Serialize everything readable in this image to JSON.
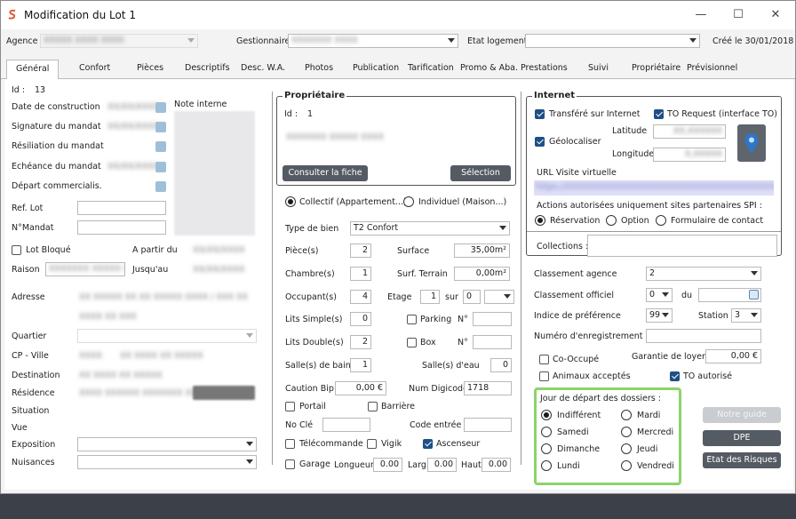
{
  "window": {
    "title": "Modification du Lot 1",
    "btn_min": "—",
    "btn_max": "☐",
    "btn_close": "✕"
  },
  "header": {
    "agence_label": "Agence",
    "agence_value": "XXXXX XXXX XXXX",
    "gestionnaire_label": "Gestionnaire",
    "gestionnaire_value": "XXXXXXX XXXX",
    "etat_label": "Etat logement",
    "etat_value": "",
    "created": "Créé le 30/01/2018"
  },
  "tabs": [
    "Général",
    "Confort",
    "Pièces",
    "Descriptifs",
    "Desc. W.A.",
    "Photos",
    "Publication",
    "Tarification",
    "Promo & Aba.",
    "Prestations",
    "Suivi",
    "Propriétaire",
    "Prévisionnel"
  ],
  "left": {
    "id_label": "Id :",
    "id_value": "13",
    "date_construction": "Date de construction",
    "signature_mandat": "Signature du mandat",
    "resiliation_mandat": "Résiliation du mandat",
    "echeance_mandat": "Echéance du mandat",
    "depart_commercialis": "Départ commercialis.",
    "note_interne": "Note interne",
    "date_blur1": "XX/XX/XXXX",
    "date_blur2": "XX/XX/XXXX",
    "date_blur3": "XX/XX/XXXX",
    "ref_lot": "Ref. Lot",
    "n_mandat": "N°Mandat",
    "lot_bloque": "Lot Bloqué",
    "a_partir_du": "A partir du",
    "raison": "Raison",
    "jusquau": "Jusqu'au",
    "raison_value": "XXXXXXX XXXXX XXXXX",
    "date_from": "XX/XX/XXXX",
    "date_to": "XX/XX/XXXX",
    "adresse": "Adresse",
    "adresse_line1": "XX XXXXX XX XX XXXXX XXXX / XXX XX",
    "adresse_line2": "XXXX XX XXX",
    "quartier": "Quartier",
    "cp_ville": "CP - Ville",
    "cp_value": "XXXX",
    "ville_value": "XX XXXX XX XXXXX",
    "destination": "Destination",
    "destination_value": "XX XXXX XX XXXXX",
    "residence": "Résidence",
    "residence_value": "XXXX XXXXXX XXXXXXX XX",
    "situation": "Situation",
    "vue": "Vue",
    "exposition": "Exposition",
    "nuisances": "Nuisances"
  },
  "middle": {
    "proprietaire_title": "Propriétaire",
    "id_label": "Id :",
    "id_value": "1",
    "owner_blur": "XXXXXXX XXXXX XXXX",
    "consulter_btn": "Consulter la fiche",
    "selection_btn": "Sélection",
    "collectif": "Collectif (Appartement...)",
    "individuel": "Individuel (Maison...)",
    "type_bien_label": "Type de bien",
    "type_bien_value": "T2 Confort",
    "pieces": "Pièce(s)",
    "pieces_value": "2",
    "surface": "Surface",
    "surface_value": "35,00m²",
    "chambres": "Chambre(s)",
    "chambres_value": "1",
    "surf_terrain": "Surf. Terrain",
    "surf_terrain_value": "0,00m²",
    "occupants": "Occupant(s)",
    "occupants_value": "4",
    "etage": "Etage",
    "etage_value": "1",
    "sur": "sur",
    "sur_value": "0",
    "lits_simple": "Lits Simple(s)",
    "lits_simple_value": "0",
    "parking": "Parking",
    "no_label": "N°",
    "lits_double": "Lits Double(s)",
    "lits_double_value": "2",
    "box": "Box",
    "salles_bains": "Salle(s) de bains",
    "salles_bains_value": "1",
    "salles_eau": "Salle(s) d'eau",
    "salles_eau_value": "0",
    "caution_bip": "Caution Bip",
    "caution_value": "0,00 €",
    "num_digicode": "Num Digicode",
    "digicode_value": "1718",
    "portail": "Portail",
    "barriere": "Barrière",
    "no_cle": "No Clé",
    "code_entree": "Code entrée",
    "telecommande": "Télécommande",
    "vigik": "Vigik",
    "ascenseur": "Ascenseur",
    "garage": "Garage",
    "longueur": "Longueur",
    "longueur_value": "0.00",
    "larg": "Larg.",
    "larg_value": "0.00",
    "haut": "Haut.",
    "haut_value": "0.00"
  },
  "right": {
    "internet_title": "Internet",
    "transfere": "Transféré sur Internet",
    "to_request": "TO Request (interface TO)",
    "geolocaliser": "Géolocaliser",
    "latitude": "Latitude",
    "longitude": "Longitude",
    "lat_value": "XX,XXXXXX",
    "lon_value": "X,XXXXX",
    "url_visite": "URL Visite virtuelle",
    "url_value": "https://XXXXXXXXXXXXXXXXXXXXXXXXXXXXXXXXXXXXXXXXXX",
    "actions": "Actions autorisées uniquement sites partenaires SPI :",
    "reservation": "Réservation",
    "option": "Option",
    "formulaire": "Formulaire de contact",
    "collections": "Collections :",
    "classement_agence": "Classement agence",
    "classement_agence_value": "2",
    "classement_officiel": "Classement officiel",
    "classement_officiel_value": "0",
    "du": "du",
    "indice": "Indice de préférence",
    "indice_value": "99",
    "station": "Station",
    "station_value": "3",
    "num_enregistrement": "Numéro d'enregistrement",
    "co_occupe": "Co-Occupé",
    "garantie_loyer": "Garantie de loyer",
    "garantie_value": "0,00 €",
    "animaux": "Animaux acceptés",
    "to_autorise": "TO autorisé",
    "jour_depart": "Jour de départ des dossiers :",
    "days": {
      "indifferent": "Indifférent",
      "mardi": "Mardi",
      "samedi": "Samedi",
      "mercredi": "Mercredi",
      "dimanche": "Dimanche",
      "jeudi": "Jeudi",
      "lundi": "Lundi",
      "vendredi": "Vendredi"
    },
    "notre_guide": "Notre guide",
    "dpe": "DPE",
    "etat_risques": "Etat des Risques"
  },
  "colors": {
    "accent": "#1e4f86",
    "highlight": "#8cd36b",
    "button": "#555b63"
  }
}
